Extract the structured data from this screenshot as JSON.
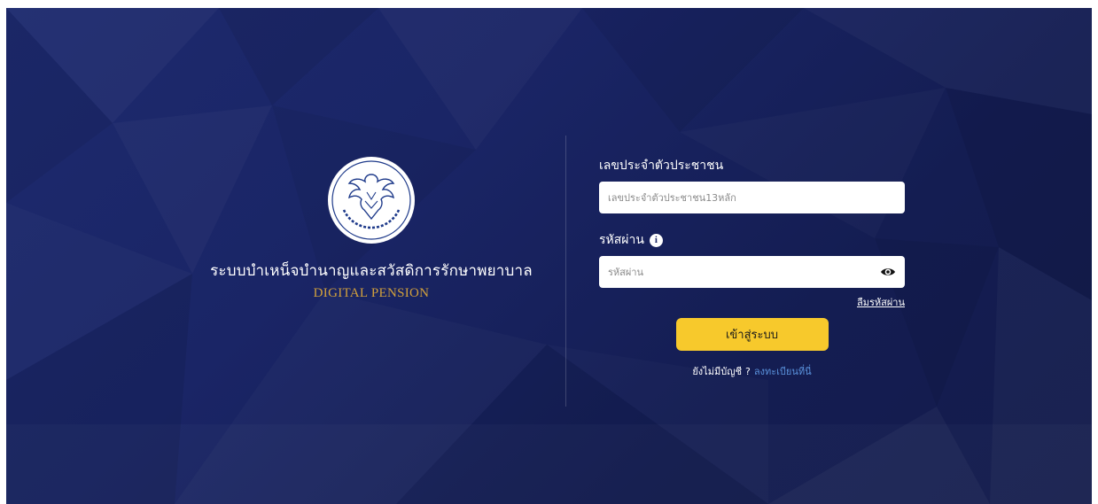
{
  "brand": {
    "logo_alt": "emblem-garuda",
    "system_name": "ระบบบำเหน็จบำนาญและสวัสดิการรักษาพยาบาล",
    "system_sub": "DIGITAL PENSION"
  },
  "form": {
    "id_label": "เลขประจำตัวประชาชน",
    "id_placeholder": "เลขประจำตัวประชาชน13หลัก",
    "id_value": "",
    "password_label": "รหัสผ่าน",
    "password_placeholder": "รหัสผ่าน",
    "password_value": "",
    "forgot_label": "ลืมรหัสผ่าน",
    "login_label": "เข้าสู่ระบบ",
    "no_account_text": "ยังไม่มีบัญชี",
    "question_mark": "?",
    "register_label": "ลงทะเบียนที่นี่"
  },
  "icons": {
    "info": "info-icon",
    "eye": "eye-icon"
  },
  "colors": {
    "background": "#1a2566",
    "accent_button": "#f7c92c",
    "brand_gold": "#d2a13c",
    "link": "#5b93dd"
  }
}
